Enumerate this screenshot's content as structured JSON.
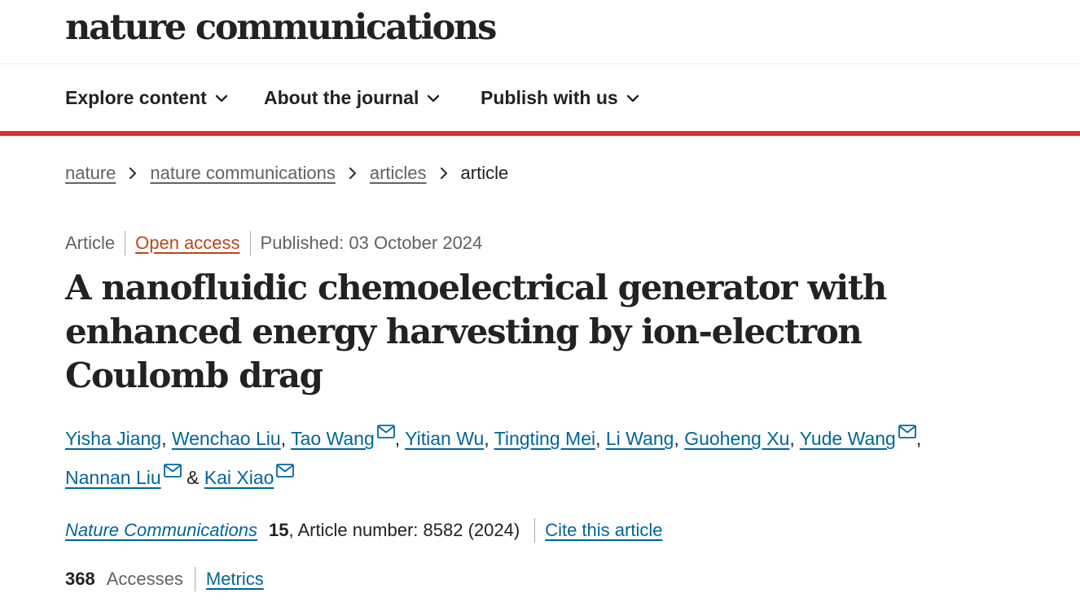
{
  "header": {
    "logo_text": "nature communications"
  },
  "nav": {
    "items": [
      {
        "label": "Explore content",
        "icon": "chevron-down-icon"
      },
      {
        "label": "About the journal",
        "icon": "chevron-down-icon"
      },
      {
        "label": "Publish with us",
        "icon": "chevron-down-icon"
      }
    ],
    "accent_color": "#e0312b"
  },
  "breadcrumb": {
    "items": [
      "nature",
      "nature communications",
      "articles"
    ],
    "current": "article",
    "separator_icon": "chevron-right-icon"
  },
  "article": {
    "type": "Article",
    "access": "Open access",
    "published": "Published: 03 October 2024",
    "title": "A nanofluidic chemoelectrical generator with enhanced energy harvesting by ion-electron Coulomb drag",
    "authors": [
      {
        "name": "Yisha Jiang",
        "email": false
      },
      {
        "name": "Wenchao Liu",
        "email": false
      },
      {
        "name": "Tao Wang",
        "email": true
      },
      {
        "name": "Yitian Wu",
        "email": false
      },
      {
        "name": "Tingting Mei",
        "email": false
      },
      {
        "name": "Li Wang",
        "email": false
      },
      {
        "name": "Guoheng Xu",
        "email": false
      },
      {
        "name": "Yude Wang",
        "email": true
      },
      {
        "name": "Nannan Liu",
        "email": true
      },
      {
        "name": "Kai Xiao",
        "email": true
      }
    ],
    "authors_joiner": "&",
    "journal_name": "Nature Communications",
    "volume": "15",
    "article_number": ", Article number: 8582 (2024)",
    "cite_label": "Cite this article",
    "accesses_count": "368",
    "accesses_label": "Accesses",
    "metrics_label": "Metrics"
  },
  "colors": {
    "link": "#006699",
    "open_access": "#b44a1b",
    "muted": "#626262",
    "text": "#222222"
  }
}
